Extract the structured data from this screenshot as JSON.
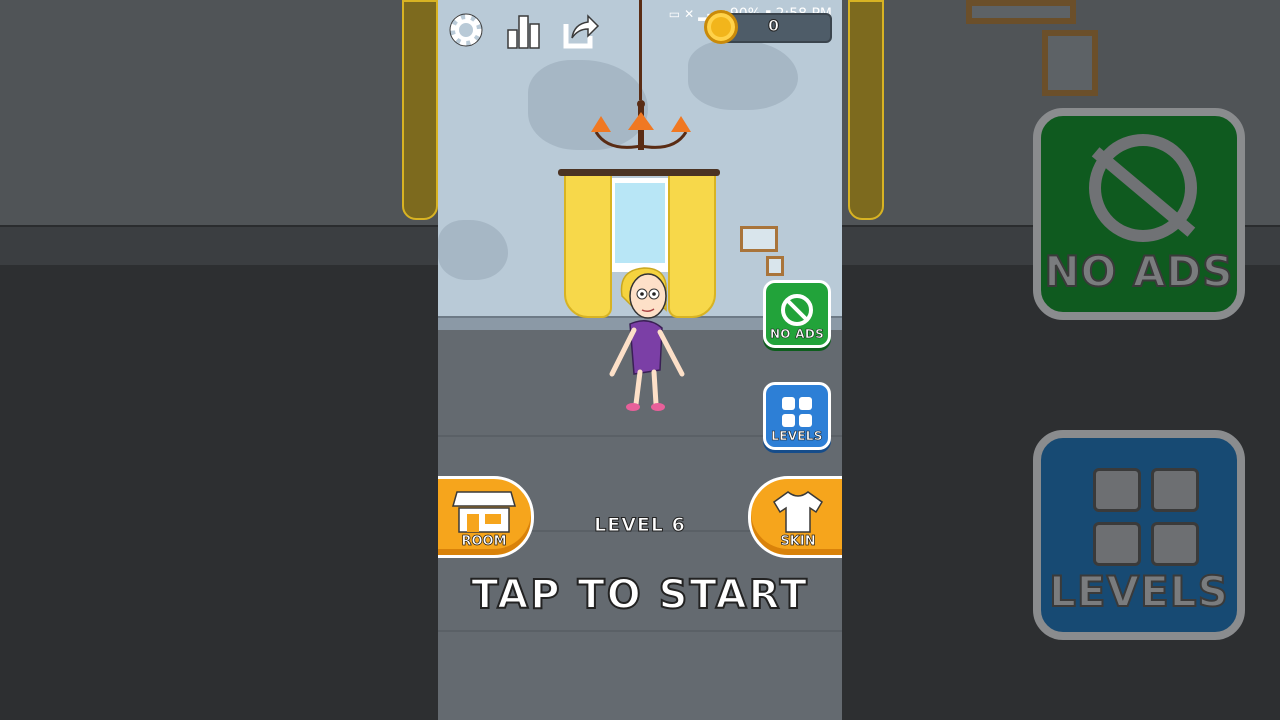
{
  "status_bar": {
    "battery": "90%",
    "time": "2:58 PM"
  },
  "toolbar": {
    "icons": [
      "gear-icon",
      "leaderboard-icon",
      "share-icon"
    ]
  },
  "currency": {
    "coin_count": "0"
  },
  "side_buttons": {
    "no_ads_label": "NO ADS",
    "levels_label": "LEVELS"
  },
  "bottom": {
    "room_label": "ROOM",
    "skin_label": "SKIN",
    "level_text": "LEVEL 6",
    "tap_text": "TAP TO START"
  },
  "colors": {
    "accent_orange": "#f6a51c",
    "no_ads_green": "#22a33a",
    "levels_blue": "#2d7fd6",
    "wall": "#b9cad7",
    "floor": "#646a70"
  }
}
